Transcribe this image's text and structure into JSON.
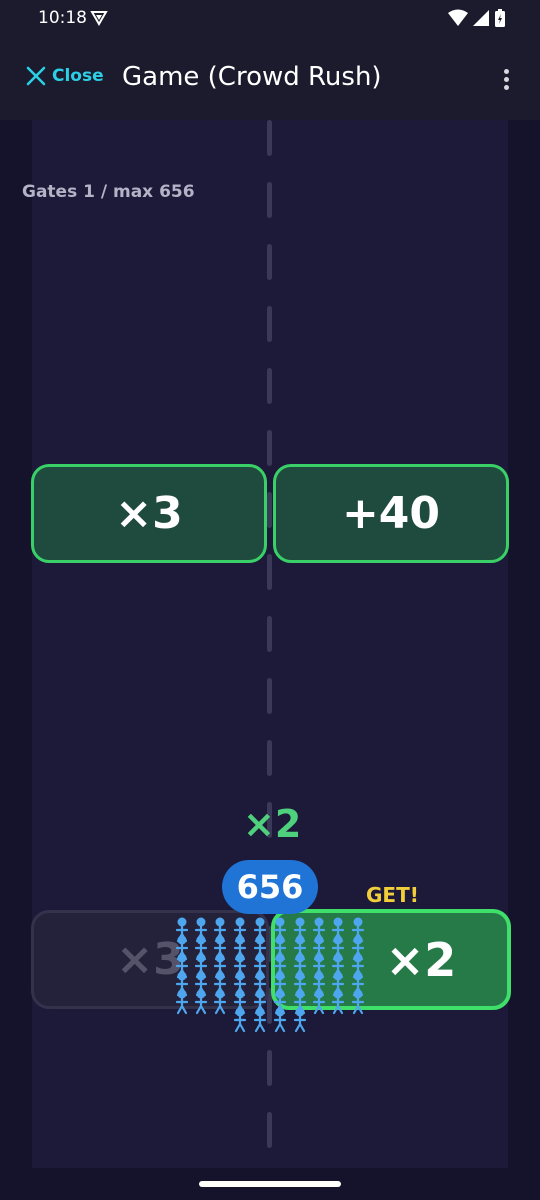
{
  "status_bar": {
    "time": "10:18"
  },
  "app_bar": {
    "close_label": "Close",
    "title": "Game (Crowd Rush)",
    "close_icon": "close-icon",
    "menu_icon": "more-vert-icon"
  },
  "hud": {
    "gates_text": "Gates 1 / max 656"
  },
  "gates": {
    "upper_left": "×3",
    "upper_right": "+40",
    "lower_left": "×3",
    "lower_right": "×2"
  },
  "crowd": {
    "bonus_label": "×2",
    "count": "656",
    "get_label": "GET!"
  },
  "colors": {
    "accent": "#2bd0e6",
    "gate_border": "#3ad068",
    "gate_fill": "#1f4a3e",
    "active_gate_fill": "#267a48",
    "crowd": "#4ea6ee",
    "badge": "#1f74d6",
    "get": "#f2cf3a"
  }
}
